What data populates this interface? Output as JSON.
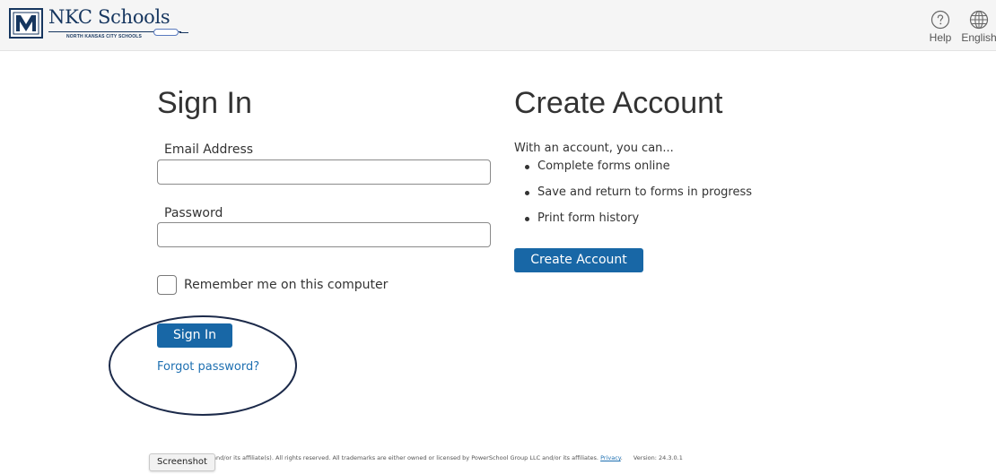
{
  "header": {
    "logo_name": "NKC Schools",
    "logo_subtitle": "NORTH KANSAS CITY SCHOOLS",
    "help_label": "Help",
    "language_label": "English"
  },
  "sign_in": {
    "title": "Sign In",
    "email_label": "Email Address",
    "email_value": "",
    "password_label": "Password",
    "password_value": "",
    "remember_label": "Remember me on this computer",
    "remember_checked": false,
    "submit_label": "Sign In",
    "forgot_label": "Forgot password?"
  },
  "create_account": {
    "title": "Create Account",
    "intro": "With an account, you can...",
    "benefits": [
      "Complete forms online",
      "Save and return to forms in progress",
      "Print form history"
    ],
    "button_label": "Create Account"
  },
  "footer": {
    "copyright": "rSchool Group LLC and/or its affiliate(s). All rights reserved. All trademarks are either owned or licensed by PowerSchool Group LLC and/or its affiliates.",
    "privacy_label": "Privacy",
    "version": "Version: 24.3.0.1"
  },
  "tooltip": {
    "label": "Screenshot"
  },
  "colors": {
    "primary_button": "#1867a6",
    "link": "#1d6fb1",
    "brand_navy": "#16365f",
    "header_bg": "#f5f5f5",
    "annotation_ring": "#1c2a4a"
  }
}
